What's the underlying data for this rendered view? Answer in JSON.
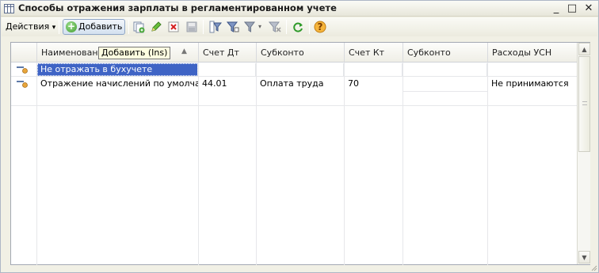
{
  "window": {
    "title": "Способы отражения зарплаты в регламентированном учете",
    "minimize": "_",
    "maximize": "□",
    "close": "✕"
  },
  "toolbar": {
    "actions_label": "Действия",
    "actions_arrow": "▾",
    "add_label": "Добавить",
    "add_symbol": "+",
    "icons": [
      "copy-icon",
      "edit-icon",
      "delete-icon",
      "save-icon",
      "filter-icon",
      "filter-by-value-icon",
      "filter-list-icon",
      "clear-filter-icon",
      "refresh-icon",
      "help-icon"
    ],
    "help_glyph": "?"
  },
  "tooltip": "Добавить (Ins)",
  "grid": {
    "columns": [
      "Наименование",
      "Счет Дт",
      "Субконто",
      "Счет Кт",
      "Субконто",
      "Расходы УСН"
    ],
    "rows": [
      {
        "name": "Не отражать в бухучете",
        "debit": "",
        "subconto_dt": "",
        "credit": "",
        "subconto_kt": "",
        "usn": "",
        "selected": true
      },
      {
        "name": "Отражение начислений по умолчанию",
        "debit": "44.01",
        "subconto_dt": "Оплата труда",
        "credit": "70",
        "subconto_kt": "",
        "usn": "Не принимаются",
        "selected": false
      }
    ]
  },
  "colors": {
    "selection": "#3f64c5",
    "window_bg": "#f1f0e5",
    "add_button": "#d3e0ef"
  }
}
